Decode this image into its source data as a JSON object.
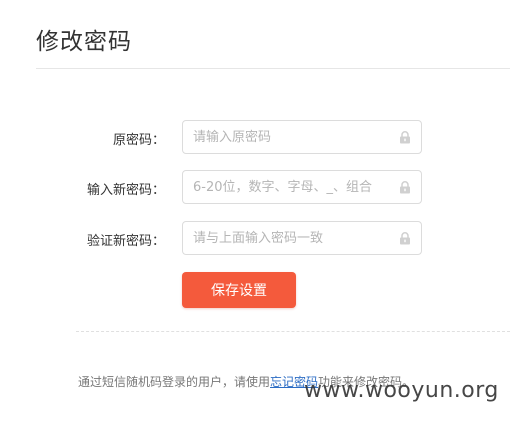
{
  "page": {
    "title": "修改密码"
  },
  "form": {
    "fields": [
      {
        "label": "原密码：",
        "placeholder": "请输入原密码",
        "value": ""
      },
      {
        "label": "输入新密码：",
        "placeholder": "6-20位，数字、字母、_、组合",
        "value": ""
      },
      {
        "label": "验证新密码：",
        "placeholder": "请与上面输入密码一致",
        "value": ""
      }
    ],
    "save_label": "保存设置",
    "field_icon": "lock-icon"
  },
  "notice": {
    "before": "通过短信随机码登录的用户，请使用",
    "link": "忘记密码",
    "after": "功能来修改密码。"
  },
  "watermark": "www.wooyun.org",
  "colors": {
    "accent": "#f45a3c",
    "link": "#2b6cc4",
    "border": "#dcdcdc",
    "placeholder": "#b5b5b5"
  }
}
